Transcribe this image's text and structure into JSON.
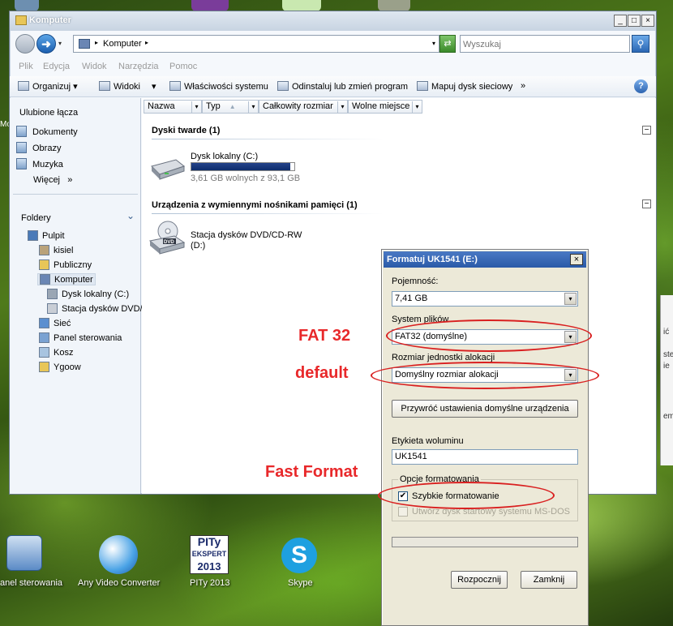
{
  "desktop": {
    "top_icon_labels": [],
    "left_edge_fragment": "Mo",
    "icons": [
      {
        "label": "anel sterowania"
      },
      {
        "label": "Any Video Converter"
      },
      {
        "label": "PITy 2013",
        "badge_line1": "PITy",
        "badge_line2": "EKSPERT",
        "badge_line3": "2013"
      },
      {
        "label": "Skype"
      }
    ],
    "right_window_fragments": [
      "ić",
      "ste",
      "ie",
      "em"
    ]
  },
  "explorer": {
    "title": "Komputer",
    "window_buttons": [
      "_",
      "□",
      "×"
    ],
    "address": {
      "location": "Komputer",
      "sep": "▸",
      "drop": "▾"
    },
    "refresh_symbol": "⇄",
    "search": {
      "placeholder": "Wyszukaj",
      "button_symbol": "⚲"
    },
    "menu": [
      "Plik",
      "Edycja",
      "Widok",
      "Narzędzia",
      "Pomoc"
    ],
    "toolbar": {
      "organize": "Organizuj",
      "views": "Widoki",
      "properties": "Właściwości systemu",
      "uninstall": "Odinstaluj lub zmień program",
      "map_drive": "Mapuj dysk sieciowy",
      "more": "»",
      "drop": "▾",
      "help": "?"
    },
    "left_pane": {
      "favorites_title": "Ulubione łącza",
      "favorites": [
        "Dokumenty",
        "Obrazy",
        "Muzyka"
      ],
      "more": "Więcej",
      "more_arrow": "»",
      "folders_title": "Foldery",
      "folders_chevron": "⌄",
      "tree": [
        "Pulpit",
        "kisiel",
        "Publiczny",
        "Komputer",
        "Dysk lokalny (C:)",
        "Stacja dysków DVD/",
        "Sieć",
        "Panel sterowania",
        "Kosz",
        "Ygoow"
      ]
    },
    "columns": [
      {
        "label": "Nazwa"
      },
      {
        "label": "Typ",
        "sort": "▲"
      },
      {
        "label": "Całkowity rozmiar"
      },
      {
        "label": "Wolne miejsce"
      }
    ],
    "groups": [
      {
        "title": "Dyski twarde (1)",
        "collapse": "−"
      },
      {
        "title": "Urządzenia z wymiennymi nośnikami pamięci (1)",
        "collapse": "−"
      }
    ],
    "drive_c": {
      "name": "Dysk lokalny (C:)",
      "free_text": "3,61 GB wolnych z 93,1 GB",
      "used_fraction": 0.961
    },
    "dvd": {
      "name": "Stacja dysków DVD/CD-RW",
      "letter": "(D:)",
      "badge": "DVD"
    }
  },
  "format_dialog": {
    "title": "Formatuj UK1541 (E:)",
    "close": "×",
    "capacity_label": "Pojemność:",
    "capacity_value": "7,41 GB",
    "fs_label": "System plików",
    "fs_value": "FAT32 (domyślne)",
    "alloc_label": "Rozmiar jednostki alokacji",
    "alloc_value": "Domyślny rozmiar alokacji",
    "restore_button": "Przywróć ustawienia domyślne urządzenia",
    "volume_label": "Etykieta woluminu",
    "volume_value": "UK1541",
    "options_title": "Opcje formatowania",
    "quick_format": {
      "label": "Szybkie formatowanie",
      "checked": true,
      "mark": "✔"
    },
    "msdos": {
      "label": "Utwórz dysk startowy systemu MS-DOS",
      "checked": false
    },
    "select_arrow": "▾",
    "start_button": "Rozpocznij",
    "close_button": "Zamknij"
  },
  "annotations": {
    "fat32": "FAT 32",
    "default": "default",
    "fast": "Fast Format",
    "color": "#e8282a"
  }
}
